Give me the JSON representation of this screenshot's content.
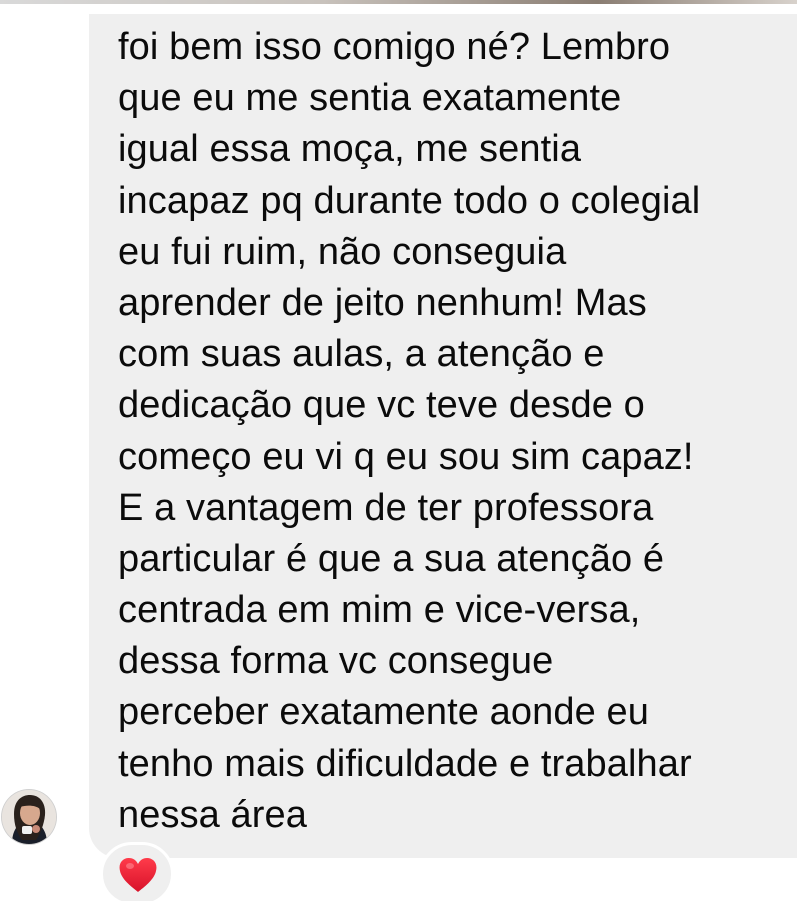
{
  "conversation": {
    "message": {
      "lines": [
        "foi bem isso comigo né? Lembro",
        "que eu me sentia exatamente",
        "igual essa moça, me sentia",
        "incapaz pq durante todo o colegial",
        "eu fui ruim, não conseguia",
        "aprender de jeito nenhum! Mas",
        "com suas aulas, a atenção e",
        "dedicação que vc teve desde o",
        "começo eu vi q eu sou sim capaz!",
        "E a vantagem de ter professora",
        "particular é que a sua atenção é",
        "centrada em mim e vice-versa,",
        "dessa forma vc consegue",
        "perceber exatamente aonde eu",
        "tenho mais dificuldade e trabalhar",
        "nessa área"
      ]
    },
    "sender": {
      "avatar_icon": "user-avatar-photo"
    },
    "reaction": {
      "icon": "red-heart-icon",
      "color": "#e11d2e"
    }
  },
  "colors": {
    "bubble": "#efefef",
    "text": "#0b0b0b",
    "background": "#ffffff"
  }
}
